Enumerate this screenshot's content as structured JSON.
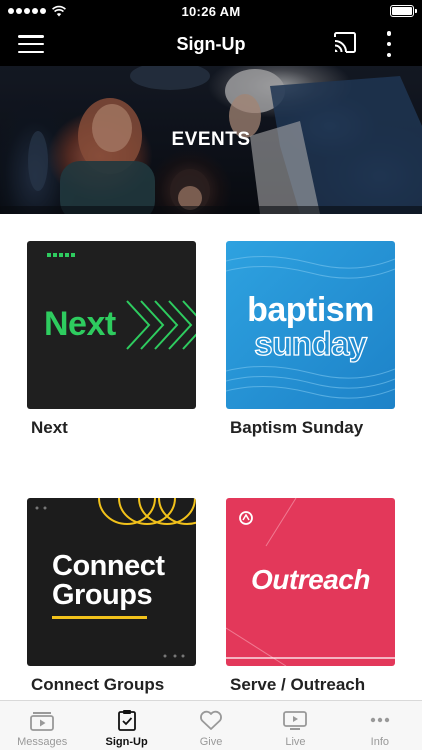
{
  "status_bar": {
    "time": "10:26 AM"
  },
  "nav": {
    "title": "Sign-Up"
  },
  "hero": {
    "title": "EVENTS"
  },
  "cards": [
    {
      "title": "Next",
      "subtitle": "",
      "thumb_text": [
        "Next"
      ]
    },
    {
      "title": "Baptism Sunday",
      "subtitle": "",
      "thumb_text": [
        "baptism",
        "sunday"
      ]
    },
    {
      "title": "Connect Groups",
      "subtitle": "",
      "thumb_text": [
        "Connect",
        "Groups"
      ]
    },
    {
      "title": "Serve / Outreach",
      "subtitle": "",
      "thumb_text": [
        "Outreach"
      ]
    }
  ],
  "tabs": [
    {
      "label": "Messages",
      "icon": "messages-icon",
      "active": false
    },
    {
      "label": "Sign-Up",
      "icon": "signup-clipboard-icon",
      "active": true
    },
    {
      "label": "Give",
      "icon": "heart-icon",
      "active": false
    },
    {
      "label": "Live",
      "icon": "live-tv-icon",
      "active": false
    },
    {
      "label": "Info",
      "icon": "more-dots-icon",
      "active": false
    }
  ],
  "colors": {
    "nav_background": "#000000",
    "next_green": "#2ecc5f",
    "baptism_blue": "#2ea2e0",
    "connect_gold": "#f2c21b",
    "outreach_red": "#e3385a",
    "tab_active": "#111111",
    "tab_inactive": "#999999"
  }
}
